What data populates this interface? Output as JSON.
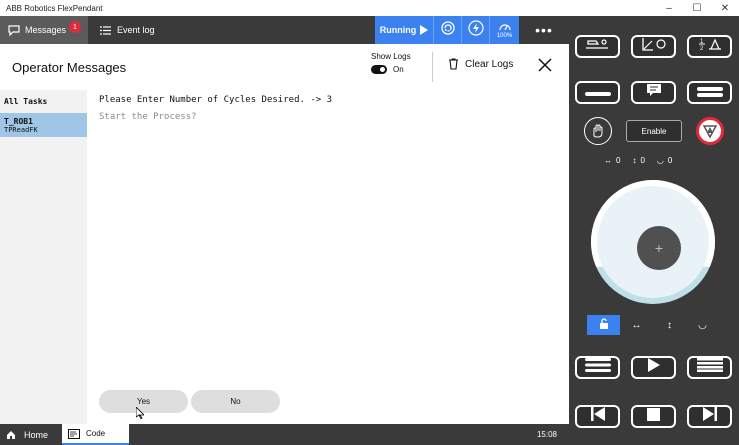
{
  "window": {
    "title": "ABB Robotics FlexPendant",
    "minimize": "–",
    "maximize": "☐",
    "close": "✕"
  },
  "topbar": {
    "messages_tab": "Messages",
    "messages_badge": "1",
    "eventlog_tab": "Event log",
    "run_label": "Running",
    "speed_label": "100%",
    "more": "•••"
  },
  "header": {
    "title": "Operator Messages",
    "showlogs_label": "Show Logs",
    "showlogs_state": "On",
    "clearlogs_label": "Clear Logs"
  },
  "tasks": {
    "title": "All Tasks",
    "items": [
      {
        "name": "T_ROB1",
        "sub": "TPReadFK"
      }
    ]
  },
  "messages": {
    "line1": "Please Enter Number of Cycles Desired. -> 3",
    "line2": "Start the Process?",
    "yes_label": "Yes",
    "no_label": "No"
  },
  "bottombar": {
    "home_label": "Home",
    "code_tab_label": "Code",
    "clock": "15:08"
  },
  "jog": {
    "enable_label": "Enable",
    "axis_values": [
      "0",
      "0",
      "0"
    ]
  }
}
